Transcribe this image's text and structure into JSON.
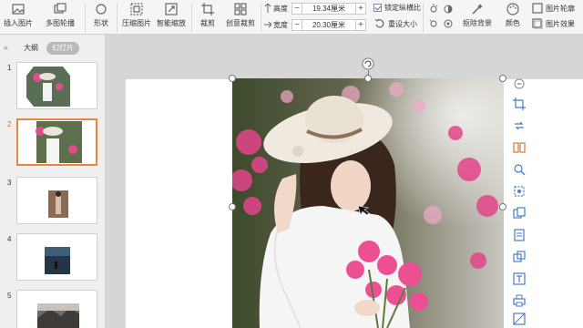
{
  "ribbon": {
    "insert_picture": "插入图片",
    "multi_outline": "多图轮播",
    "shape": "形状",
    "compress_picture": "压缩图片",
    "smart_zoom": "智能缩放",
    "crop": "裁剪",
    "creative_crop": "创意裁剪",
    "height_label": "高度",
    "height_value": "19.34厘米",
    "width_label": "宽度",
    "width_value": "20.30厘米",
    "lock_ratio": "锁定纵横比",
    "reset_size": "重设大小",
    "remove_background": "抠除背景",
    "color": "颜色",
    "picture_outline": "图片轮廓",
    "picture_effect": "图片效果",
    "accent_color": "#2b6fd6"
  },
  "left_panel": {
    "collapse_icon": "«",
    "tab_outline": "大纲",
    "tab_slides": "幻灯片",
    "slides": [
      {
        "num": "1"
      },
      {
        "num": "2"
      },
      {
        "num": "3"
      },
      {
        "num": "4"
      },
      {
        "num": "5"
      }
    ],
    "active_color": "#e8853f"
  },
  "float_bar": {
    "collapse_icon": "minus",
    "icons": [
      "crop-icon",
      "replace-icon",
      "split-icon",
      "zoom-icon",
      "effect-icon",
      "copy-icon",
      "doc-icon",
      "layer-icon",
      "text-icon",
      "print-icon",
      "hatch-icon"
    ]
  }
}
